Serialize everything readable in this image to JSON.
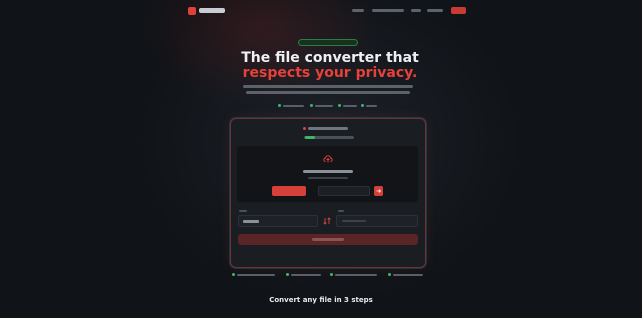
{
  "hero": {
    "headline_line1": "The file converter that",
    "headline_line2": "respects your privacy.",
    "headline_accent_color": "#e6413b"
  },
  "steps_section": {
    "title": "Convert any file in 3 steps"
  },
  "icons": {
    "drop_zone": "cloud-upload-icon",
    "swap": "swap-arrows-icon",
    "url_submit": "arrow-right-icon"
  },
  "colors": {
    "accent": "#d6403a",
    "success": "#3fb56a",
    "background": "#101317",
    "card_border": "#6a3338"
  }
}
